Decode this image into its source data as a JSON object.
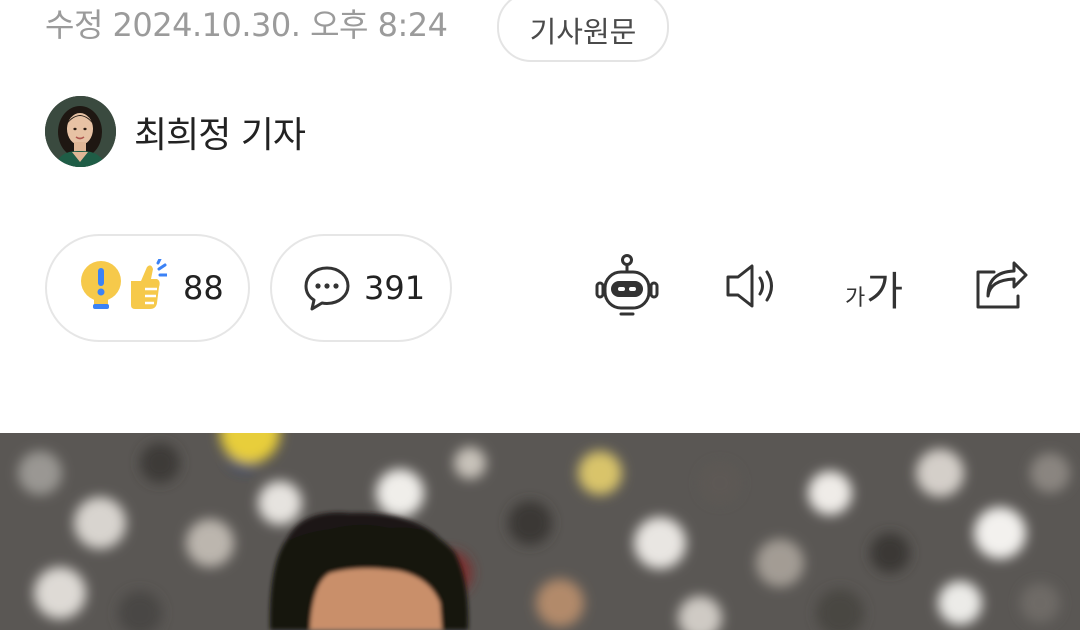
{
  "article": {
    "modified_date": "수정 2024.10.30. 오후 8:24",
    "origin_button_label": "기사원문",
    "reporter_name": "최희정 기자"
  },
  "actions": {
    "reaction": {
      "icons": [
        "lightbulb-icon",
        "thumbs-up-icon"
      ],
      "count": "88"
    },
    "comment": {
      "icon": "speech-bubble-icon",
      "count": "391"
    }
  },
  "tools": [
    {
      "name": "ai-summary",
      "icon": "robot-icon"
    },
    {
      "name": "listen",
      "icon": "speaker-icon"
    },
    {
      "name": "font-size",
      "icon": "font-size-icon",
      "small_label": "가",
      "large_label": "가"
    },
    {
      "name": "share",
      "icon": "share-icon"
    }
  ],
  "colors": {
    "meta_text": "#9b9b9b",
    "body_text": "#222222",
    "border": "#e4e4e4",
    "lightbulb": "#f6c94a",
    "thumb": "#f6c94a",
    "bulb_mark": "#3b82f6"
  }
}
